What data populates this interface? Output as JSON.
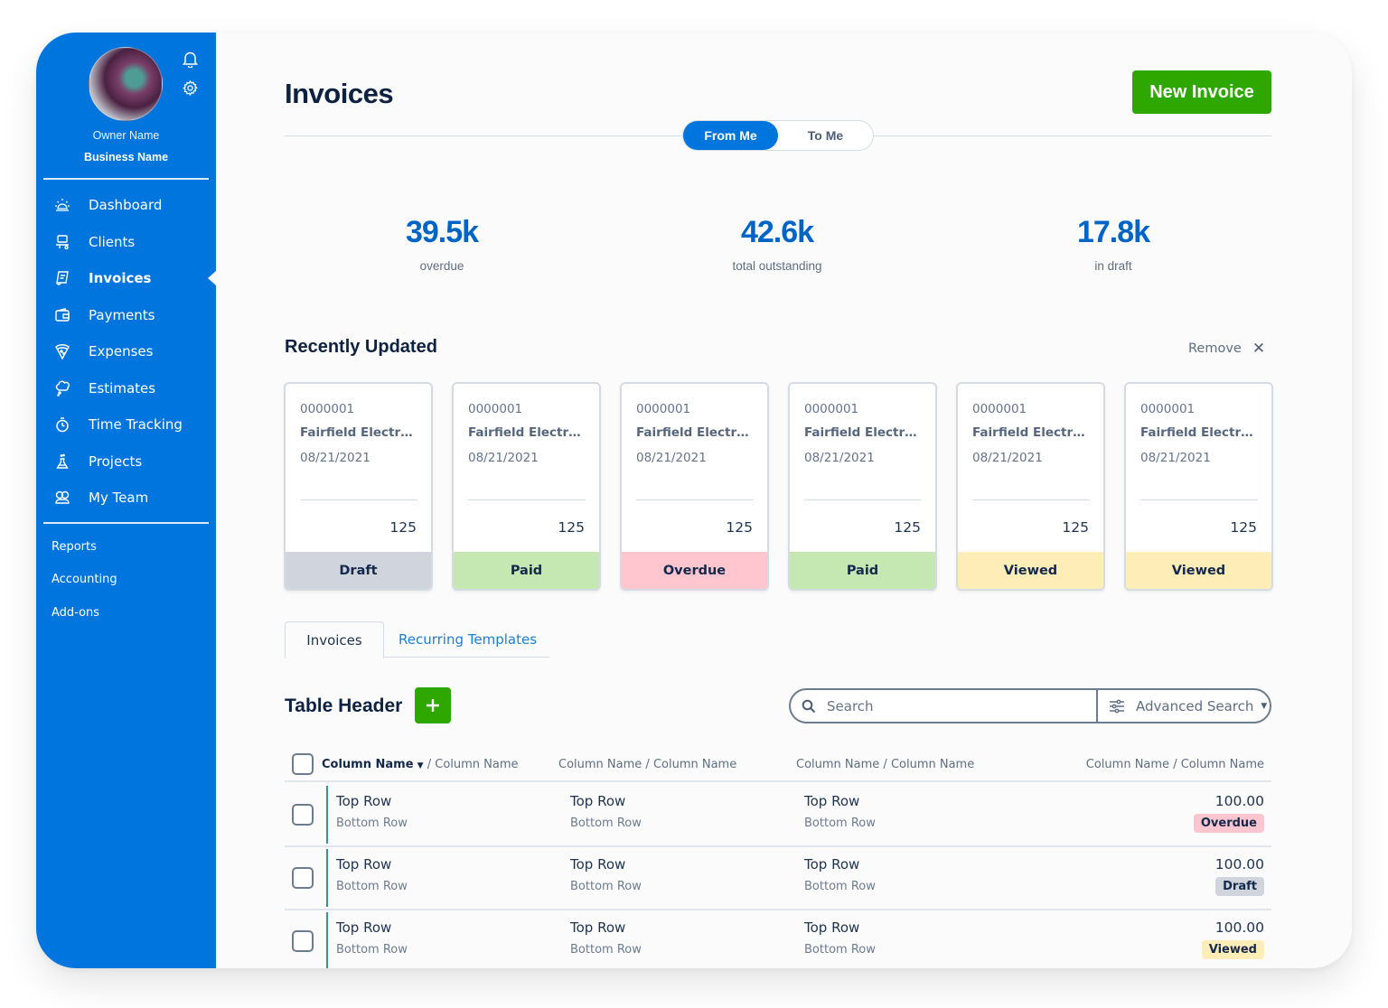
{
  "colors": {
    "brand": "#0075dd",
    "primary_action": "#2ea800",
    "stat_value": "#0063c6",
    "status": {
      "Draft": "#cfd4dd",
      "Paid": "#c5e7b2",
      "Overdue": "#ffc6cf",
      "Viewed": "#ffedb8"
    }
  },
  "sidebar": {
    "owner_name": "Owner Name",
    "business_name": "Business Name",
    "icons": {
      "notifications": "bell-icon",
      "settings": "gear-icon"
    },
    "items": [
      {
        "label": "Dashboard",
        "icon": "sun-dashboard-icon",
        "active": false
      },
      {
        "label": "Clients",
        "icon": "clients-icon",
        "active": false
      },
      {
        "label": "Invoices",
        "icon": "invoice-icon",
        "active": true
      },
      {
        "label": "Payments",
        "icon": "wallet-icon",
        "active": false
      },
      {
        "label": "Expenses",
        "icon": "pizza-icon",
        "active": false
      },
      {
        "label": "Estimates",
        "icon": "thought-bubble-icon",
        "active": false
      },
      {
        "label": "Time Tracking",
        "icon": "stopwatch-icon",
        "active": false
      },
      {
        "label": "Projects",
        "icon": "flask-icon",
        "active": false
      },
      {
        "label": "My Team",
        "icon": "team-icon",
        "active": false
      }
    ],
    "secondary_items": [
      "Reports",
      "Accounting",
      "Add-ons"
    ]
  },
  "header": {
    "title": "Invoices",
    "new_button": "New Invoice",
    "toggle": {
      "options": [
        "From Me",
        "To Me"
      ],
      "selected": "From Me"
    }
  },
  "stats": [
    {
      "value": "39.5k",
      "label": "overdue"
    },
    {
      "value": "42.6k",
      "label": "total outstanding"
    },
    {
      "value": "17.8k",
      "label": "in draft"
    }
  ],
  "recent": {
    "title": "Recently Updated",
    "remove_label": "Remove",
    "cards": [
      {
        "number": "0000001",
        "client": "Fairfield Electroni...",
        "date": "08/21/2021",
        "amount": "125",
        "status": "Draft"
      },
      {
        "number": "0000001",
        "client": "Fairfield Electroni...",
        "date": "08/21/2021",
        "amount": "125",
        "status": "Paid"
      },
      {
        "number": "0000001",
        "client": "Fairfield Electroni...",
        "date": "08/21/2021",
        "amount": "125",
        "status": "Overdue"
      },
      {
        "number": "0000001",
        "client": "Fairfield Electroni...",
        "date": "08/21/2021",
        "amount": "125",
        "status": "Paid"
      },
      {
        "number": "0000001",
        "client": "Fairfield Electroni...",
        "date": "08/21/2021",
        "amount": "125",
        "status": "Viewed"
      },
      {
        "number": "0000001",
        "client": "Fairfield Electroni...",
        "date": "08/21/2021",
        "amount": "125",
        "status": "Viewed"
      }
    ]
  },
  "tabs": [
    {
      "label": "Invoices",
      "active": true
    },
    {
      "label": "Recurring Templates",
      "active": false
    }
  ],
  "table": {
    "title": "Table Header",
    "search_placeholder": "Search",
    "advanced_search_label": "Advanced Search",
    "columns": [
      {
        "primary": "Column Name",
        "secondary": "Column Name",
        "sorted": true
      },
      {
        "primary": "Column Name",
        "secondary": "Column Name",
        "sorted": false
      },
      {
        "primary": "Column Name",
        "secondary": "Column Name",
        "sorted": false
      },
      {
        "primary": "Column Name",
        "secondary": "Column Name",
        "sorted": false
      }
    ],
    "rows": [
      {
        "c1": {
          "top": "Top Row",
          "bottom": "Bottom Row"
        },
        "c2": {
          "top": "Top Row",
          "bottom": "Bottom Row"
        },
        "c3": {
          "top": "Top Row",
          "bottom": "Bottom Row"
        },
        "amount": "100.00",
        "status": "Overdue"
      },
      {
        "c1": {
          "top": "Top Row",
          "bottom": "Bottom Row"
        },
        "c2": {
          "top": "Top Row",
          "bottom": "Bottom Row"
        },
        "c3": {
          "top": "Top Row",
          "bottom": "Bottom Row"
        },
        "amount": "100.00",
        "status": "Draft"
      },
      {
        "c1": {
          "top": "Top Row",
          "bottom": "Bottom Row"
        },
        "c2": {
          "top": "Top Row",
          "bottom": "Bottom Row"
        },
        "c3": {
          "top": "Top Row",
          "bottom": "Bottom Row"
        },
        "amount": "100.00",
        "status": "Viewed"
      }
    ]
  }
}
